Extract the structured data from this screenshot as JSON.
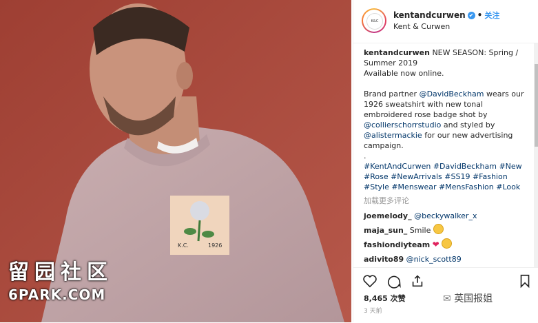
{
  "photo": {
    "watermark_cn": "留园社区",
    "watermark_en": "6PARK.COM",
    "patch_text": "K.C.",
    "patch_year": "1926"
  },
  "header": {
    "username": "kentandcurwen",
    "verified_icon": "✔",
    "follow_label": "关注",
    "subtitle": "Kent & Curwen"
  },
  "caption": {
    "username": "kentandcurwen",
    "line1": "NEW SEASON: Spring / Summer 2019",
    "line2": "Available now online.",
    "p2_a": "Brand partner ",
    "mention1": "@DavidBeckham",
    "p2_b": " wears our 1926 sweatshirt with new tonal embroidered rose badge shot by ",
    "mention2": "@collierschorrstudio",
    "p2_c": " and styled by ",
    "mention3": "@alistermackie",
    "p2_d": " for our new advertising campaign.",
    "dot": ".",
    "hashtags": "#KentAndCurwen #DavidBeckham #New #Rose #NewArrivals #SS19 #Fashion #Style #Menswear #MensFashion #Look"
  },
  "more_comments": "加载更多评论",
  "comments": [
    {
      "user": "joemelody_",
      "text": "@beckywalker_x",
      "is_link": true
    },
    {
      "user": "maja_sun_",
      "text": "Smile",
      "emoji": "grin"
    },
    {
      "user": "fashiondiyteam",
      "text": "",
      "emoji": "heart-cool"
    },
    {
      "user": "adivito89",
      "text": "@nick_scott89",
      "is_link": true
    }
  ],
  "footer": {
    "likes": "8,465 次赞",
    "time": "3 天前",
    "wechat_label": "英国报姐"
  }
}
